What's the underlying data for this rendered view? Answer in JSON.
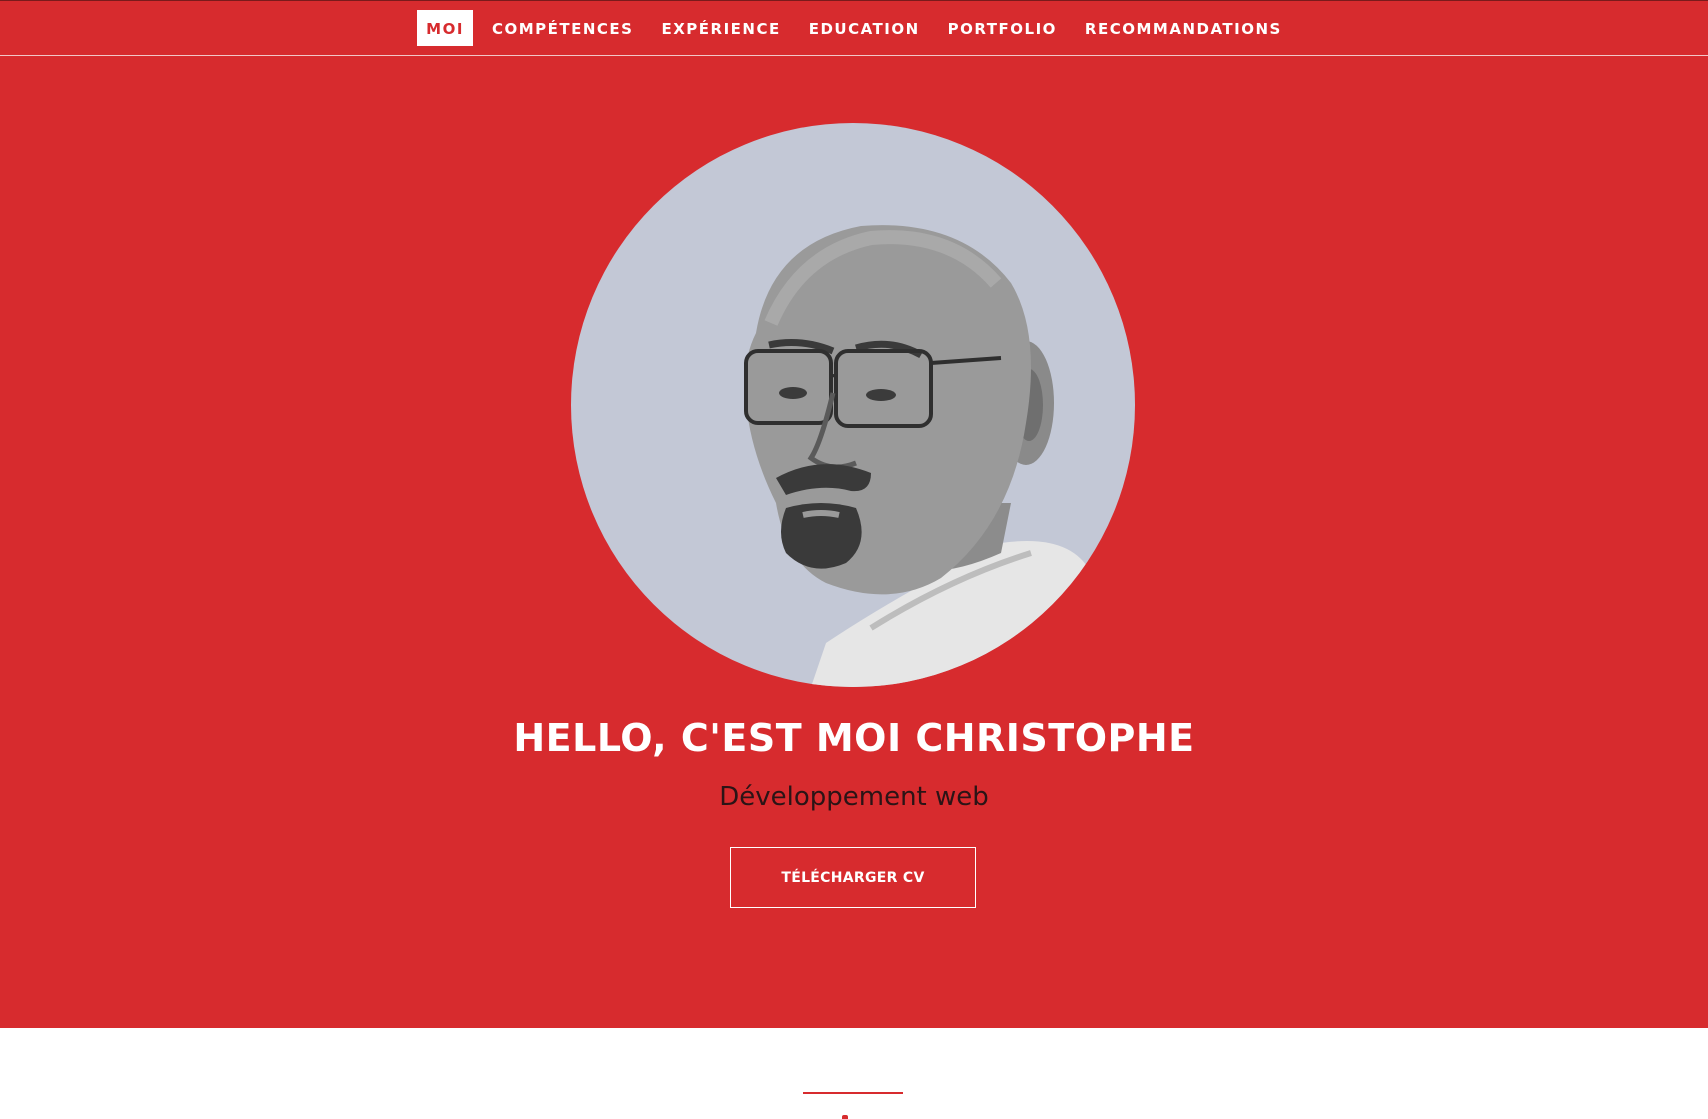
{
  "nav": {
    "items": [
      {
        "label": "MOI",
        "active": true
      },
      {
        "label": "COMPÉTENCES",
        "active": false
      },
      {
        "label": "EXPÉRIENCE",
        "active": false
      },
      {
        "label": "EDUCATION",
        "active": false
      },
      {
        "label": "PORTFOLIO",
        "active": false
      },
      {
        "label": "RECOMMANDATIONS",
        "active": false
      }
    ]
  },
  "hero": {
    "title": "HELLO, C'EST MOI CHRISTOPHE",
    "subtitle": "Développement web",
    "cv_button_label": "TÉLÉCHARGER CV"
  },
  "colors": {
    "accent": "#d72b2e",
    "avatar_bg": "#c3c8d6",
    "subtitle_text": "#2b1416"
  }
}
